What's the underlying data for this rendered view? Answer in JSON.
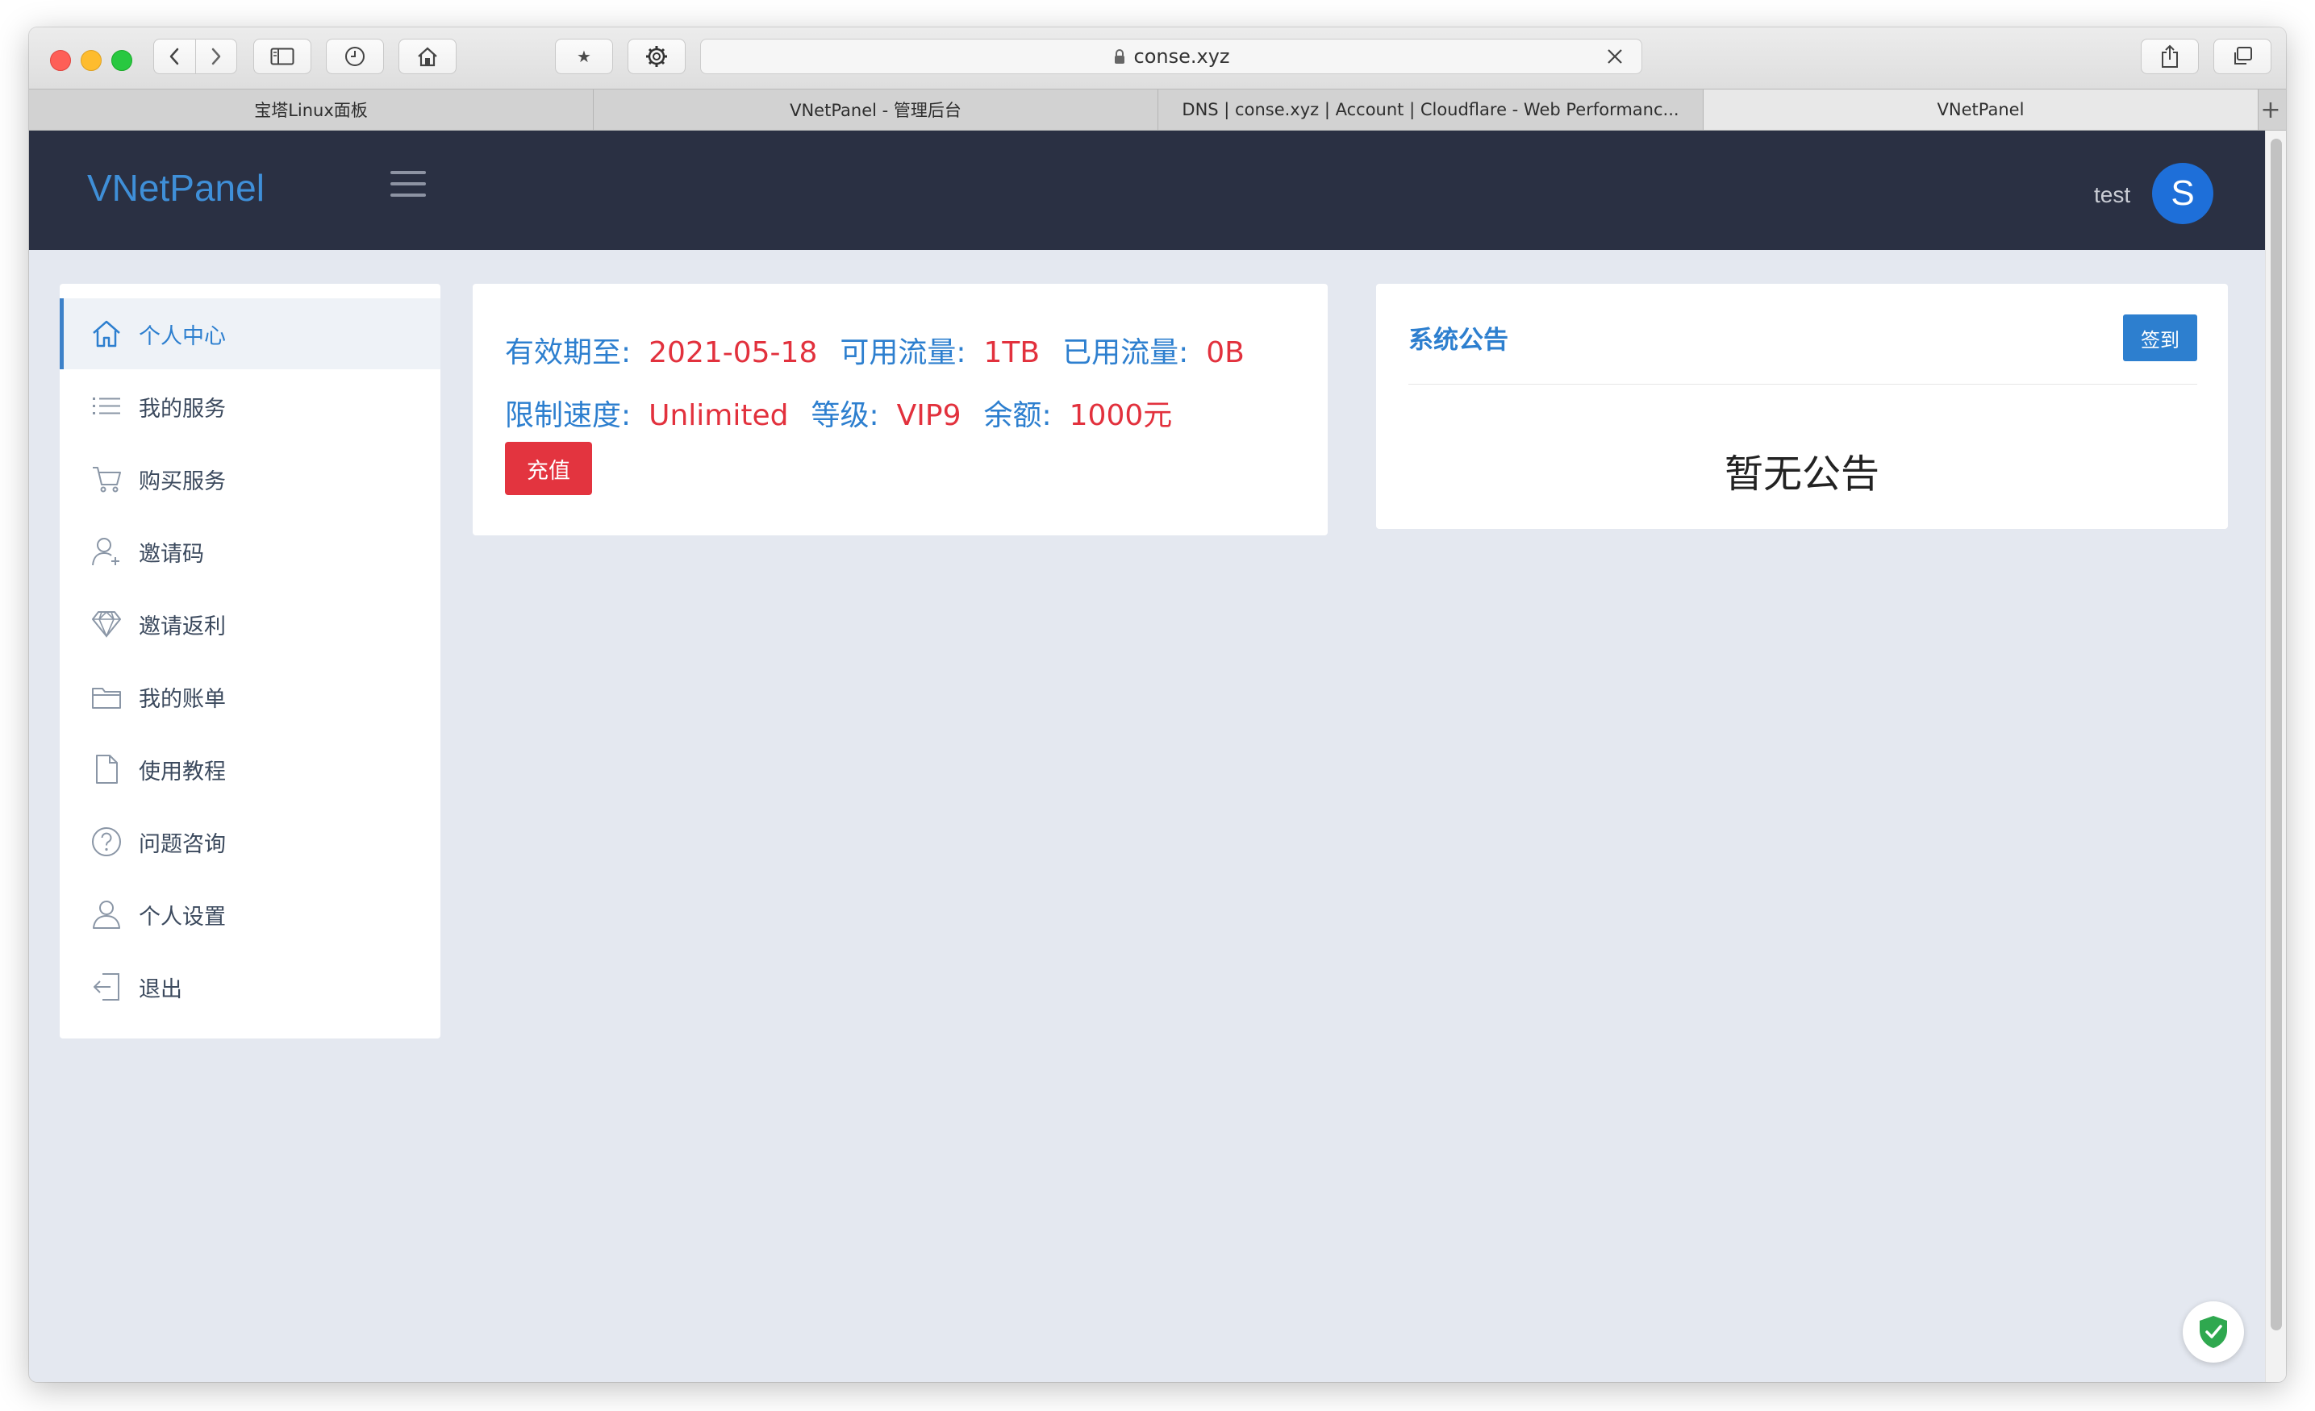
{
  "browser": {
    "url": "conse.xyz",
    "tabs": [
      {
        "label": "宝塔Linux面板"
      },
      {
        "label": "VNetPanel - 管理后台"
      },
      {
        "label": "DNS | conse.xyz | Account | Cloudflare - Web Performanc..."
      },
      {
        "label": "VNetPanel"
      }
    ],
    "new_tab": "+",
    "bookmark_star": "★"
  },
  "header": {
    "brand": "VNetPanel",
    "username": "test",
    "avatar_letter": "S"
  },
  "sidebar": {
    "items": [
      {
        "label": "个人中心",
        "icon": "home-icon",
        "active": true
      },
      {
        "label": "我的服务",
        "icon": "list-icon"
      },
      {
        "label": "购买服务",
        "icon": "cart-icon"
      },
      {
        "label": "邀请码",
        "icon": "user-add-icon"
      },
      {
        "label": "邀请返利",
        "icon": "diamond-icon"
      },
      {
        "label": "我的账单",
        "icon": "wallet-icon"
      },
      {
        "label": "使用教程",
        "icon": "document-icon"
      },
      {
        "label": "问题咨询",
        "icon": "question-icon"
      },
      {
        "label": "个人设置",
        "icon": "user-icon"
      },
      {
        "label": "退出",
        "icon": "logout-icon"
      }
    ]
  },
  "account": {
    "expiry_label": "有效期至:",
    "expiry_value": "2021-05-18",
    "available_label": "可用流量:",
    "available_value": "1TB",
    "used_label": "已用流量:",
    "used_value": "0B",
    "speed_label": "限制速度:",
    "speed_value": "Unlimited",
    "level_label": "等级:",
    "level_value": "VIP9",
    "balance_label": "余额:",
    "balance_value": "1000元",
    "recharge_label": "充值"
  },
  "announcement": {
    "title": "系统公告",
    "checkin_label": "签到",
    "empty_text": "暂无公告"
  },
  "colors": {
    "header_bg": "#2a3043",
    "brand": "#3f8fd8",
    "accent_blue": "#2d7fcf",
    "accent_red": "#e2313d",
    "page_bg": "#e4e8f0"
  }
}
